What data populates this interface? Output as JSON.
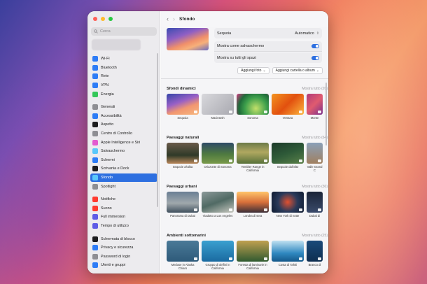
{
  "sidebar": {
    "search_placeholder": "Cerca",
    "items": [
      {
        "label": "Wi-Fi",
        "icon": "wifi-icon",
        "color": "#2d7cf6"
      },
      {
        "label": "Bluetooth",
        "icon": "bluetooth-icon",
        "color": "#2d7cf6"
      },
      {
        "label": "Rete",
        "icon": "globe-icon",
        "color": "#2d7cf6"
      },
      {
        "label": "VPN",
        "icon": "vpn-icon",
        "color": "#2d7cf6"
      },
      {
        "label": "Energia",
        "icon": "battery-icon",
        "color": "#34c759"
      },
      {
        "label": "Generali",
        "icon": "gear-icon",
        "color": "#8e8e93"
      },
      {
        "label": "Accessibilità",
        "icon": "accessibility-icon",
        "color": "#2d7cf6"
      },
      {
        "label": "Aspetto",
        "icon": "appearance-icon",
        "color": "#1c1c1e"
      },
      {
        "label": "Centro di Controllo",
        "icon": "control-center-icon",
        "color": "#8e8e93"
      },
      {
        "label": "Apple Intelligence e Siri",
        "icon": "siri-icon",
        "color": "#e35bd0"
      },
      {
        "label": "Salvaschermo",
        "icon": "screensaver-icon",
        "color": "#5ac8fa"
      },
      {
        "label": "Schermi",
        "icon": "display-icon",
        "color": "#2d7cf6"
      },
      {
        "label": "Scrivania e Dock",
        "icon": "dock-icon",
        "color": "#1c1c1e"
      },
      {
        "label": "Sfondo",
        "icon": "wallpaper-icon",
        "color": "#5ac8fa"
      },
      {
        "label": "Spotlight",
        "icon": "spotlight-icon",
        "color": "#8e8e93"
      },
      {
        "label": "Notifiche",
        "icon": "bell-icon",
        "color": "#ff3b30"
      },
      {
        "label": "Suono",
        "icon": "speaker-icon",
        "color": "#ff3b30"
      },
      {
        "label": "Full immersion",
        "icon": "moon-icon",
        "color": "#5e5ce6"
      },
      {
        "label": "Tempo di utilizzo",
        "icon": "hourglass-icon",
        "color": "#5e5ce6"
      },
      {
        "label": "Schermata di blocco",
        "icon": "lock-screen-icon",
        "color": "#1c1c1e"
      },
      {
        "label": "Privacy e sicurezza",
        "icon": "hand-icon",
        "color": "#2d7cf6"
      },
      {
        "label": "Password di login",
        "icon": "key-icon",
        "color": "#8e8e93"
      },
      {
        "label": "Utenti e gruppi",
        "icon": "users-icon",
        "color": "#2d7cf6"
      }
    ]
  },
  "header": {
    "title": "Sfondo"
  },
  "settings": {
    "wallpaper_name": "Sequoia",
    "wallpaper_mode": "Automatico",
    "screensaver_label": "Mostra come salvaschermo",
    "all_spaces_label": "Mostra su tutti gli spazi",
    "add_photo": "Aggiungi foto",
    "add_folder": "Aggiungi cartella o album"
  },
  "sections": [
    {
      "title": "Sfondi dinamici",
      "more": "Mostra tutto (20)",
      "items": [
        {
          "caption": "Sequoia",
          "bg": "linear-gradient(160deg,#3546a8,#9860c6 40%,#f29770 65%,#f6b77e)"
        },
        {
          "caption": "Macintosh",
          "bg": "linear-gradient(135deg,#d8d8dc,#a9a9b0)"
        },
        {
          "caption": "Sonoma",
          "bg": "radial-gradient(circle at 60% 70%,#c3e06a,#3ea04c 45%,#1f6b3a 70%,#d83a86)"
        },
        {
          "caption": "Ventura",
          "bg": "linear-gradient(135deg,#f3931f,#e2500f 50%,#fbb63d)"
        },
        {
          "caption": "Monte",
          "bg": "linear-gradient(135deg,#b03a7a,#e05b6f 50%,#7a2e8c)"
        }
      ]
    },
    {
      "title": "Paesaggi naturali",
      "more": "Mostra tutto (64)",
      "items": [
        {
          "caption": "Sequoie al'alba",
          "bg": "linear-gradient(180deg,#6a5b4a,#2f3a28 60%,#b9875a)"
        },
        {
          "caption": "Orizzonte di Sonoma",
          "bg": "linear-gradient(180deg,#2e4a66,#4f7a40 55%,#7a9a4a)"
        },
        {
          "caption": "Tembler Range in California",
          "bg": "linear-gradient(180deg,#6b7a48,#b0a860 45%,#58713a)"
        },
        {
          "caption": "Sequoie dall'alto",
          "bg": "linear-gradient(160deg,#1c3a2a,#2e5a38 50%,#5a8048)"
        },
        {
          "caption": "Valle Grand C",
          "bg": "linear-gradient(180deg,#8aa0b8,#a08060)"
        }
      ]
    },
    {
      "title": "Paesaggi urbani",
      "more": "Mostra tutto (30)",
      "items": [
        {
          "caption": "Panorama di Dubai",
          "bg": "linear-gradient(180deg,#6a7f94,#a0a8ac 55%,#40505e)"
        },
        {
          "caption": "Viadotto a Los Angeles",
          "bg": "linear-gradient(160deg,#8a9898,#506a64 50%,#c8c8c0)"
        },
        {
          "caption": "Londra di sera",
          "bg": "linear-gradient(180deg,#ffc56a,#d8703a 50%,#3a2e38)"
        },
        {
          "caption": "New York di notte",
          "bg": "radial-gradient(circle at 50% 50%,#e05030,#2a3a5a 50%,#0e1a30)"
        },
        {
          "caption": "Dubai di",
          "bg": "linear-gradient(180deg,#1a2438,#3a4a6a)"
        }
      ]
    },
    {
      "title": "Ambienti sottomarini",
      "more": "Mostra tutto (25)",
      "items": [
        {
          "caption": "Meduse in Alaska Chiaro",
          "bg": "linear-gradient(180deg,#4a7a98,#2e5a7a)"
        },
        {
          "caption": "Gruppo di delfini in California",
          "bg": "linear-gradient(180deg,#3aa0d0,#1a6aa0)"
        },
        {
          "caption": "Foresta di laminarie in California",
          "bg": "linear-gradient(180deg,#c0a050,#305a30)"
        },
        {
          "caption": "Costa di Tahiti",
          "bg": "linear-gradient(180deg,#bfe0f0,#2f88c0 60%,#14588a)"
        },
        {
          "caption": "Branco di",
          "bg": "linear-gradient(180deg,#1a4a7a,#0e2e50)"
        }
      ]
    }
  ],
  "colors": {
    "accent": "#2d6fe0"
  }
}
